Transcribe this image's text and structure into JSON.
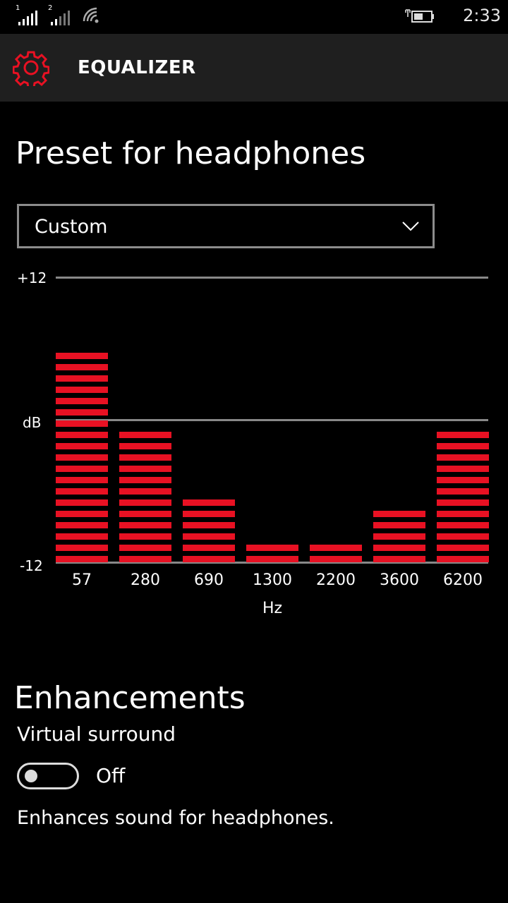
{
  "status_bar": {
    "sim1_label": "1",
    "sim2_label": "2",
    "time": "2:33",
    "icons": [
      "signal-icon",
      "signal-icon",
      "wifi-icon",
      "battery-charging-icon"
    ]
  },
  "app_bar": {
    "title": "EQUALIZER",
    "icon": "gear-icon",
    "accent_color": "#e81123"
  },
  "preset": {
    "heading": "Preset for headphones",
    "selected": "Custom"
  },
  "equalizer": {
    "top_label": "+12",
    "mid_label": "dB",
    "bottom_label": "-12",
    "unit_label": "Hz",
    "bar_color": "#e81123"
  },
  "chart_data": {
    "type": "bar",
    "categories": [
      "57",
      "280",
      "690",
      "1300",
      "2200",
      "3600",
      "6200"
    ],
    "values": [
      7,
      0,
      -6,
      -10,
      -10,
      -7,
      0
    ],
    "ylabel": "dB",
    "xlabel": "Hz",
    "ylim": [
      -12,
      12
    ],
    "unit_levels": [
      19,
      12,
      6,
      2,
      2,
      5,
      12
    ]
  },
  "enhancements": {
    "heading": "Enhancements",
    "virtual_surround_label": "Virtual surround",
    "toggle_state": "Off",
    "toggle_on": false,
    "description": "Enhances sound for headphones."
  }
}
